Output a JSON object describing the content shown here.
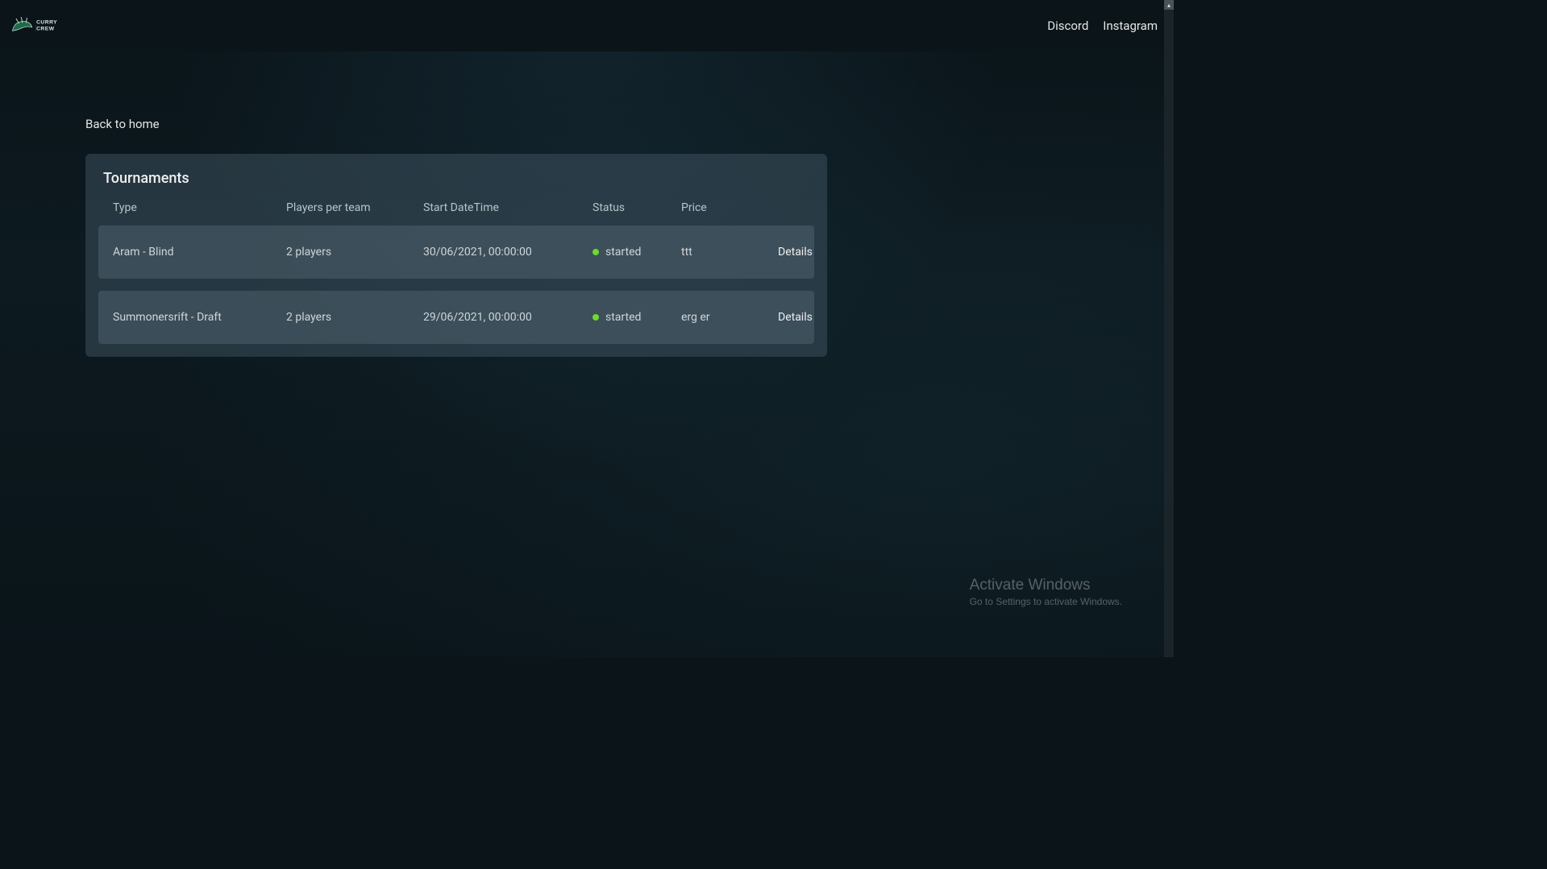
{
  "header": {
    "logo_text": "CURRY CREW",
    "nav": {
      "discord": "Discord",
      "instagram": "Instagram"
    }
  },
  "back_link": "Back to home",
  "card": {
    "title": "Tournaments",
    "columns": {
      "type": "Type",
      "players": "Players per team",
      "start": "Start DateTime",
      "status": "Status",
      "price": "Price"
    },
    "rows": [
      {
        "type": "Aram - Blind",
        "players": "2 players",
        "start": "30/06/2021, 00:00:00",
        "status": "started",
        "status_color": "#6fd92e",
        "price": "ttt",
        "details": "Details"
      },
      {
        "type": "Summonersrift - Draft",
        "players": "2 players",
        "start": "29/06/2021, 00:00:00",
        "status": "started",
        "status_color": "#6fd92e",
        "price": "erg er",
        "details": "Details"
      }
    ]
  },
  "watermark": {
    "title": "Activate Windows",
    "sub": "Go to Settings to activate Windows."
  }
}
